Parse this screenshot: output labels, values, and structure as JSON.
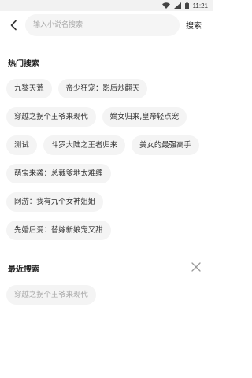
{
  "status_bar": {
    "time": "11:21",
    "icons": [
      "wifi-icon",
      "signal-icon",
      "battery-icon"
    ]
  },
  "header": {
    "back_icon": "chevron-left-icon",
    "search_placeholder": "输入小说名搜索",
    "search_value": "",
    "search_button": "搜索"
  },
  "hot_search": {
    "title": "热门搜索",
    "items": [
      "九黎天荒",
      "帝少狂宠：影后炒翻天",
      "穿越之拐个王爷来现代",
      "嫡女归来,皇帝轻点宠",
      "测试",
      "斗罗大陆之王者归来",
      "美女的最强高手",
      "萌宝来袭：总裁爹地太难缠",
      "网游：我有九个女神姐姐",
      "先婚后爱：替嫁新娘宠又甜"
    ]
  },
  "recent_search": {
    "title": "最近搜索",
    "clear_icon": "close-icon",
    "items": [
      "穿越之拐个王爷来现代"
    ]
  },
  "colors": {
    "background": "#ffffff",
    "status_bar": "#f2f2f2",
    "tag_background": "#f4f4f4",
    "search_box_background": "#f5f5f5",
    "placeholder_text": "#a9a9a9",
    "recent_text": "#a8a8a8"
  }
}
